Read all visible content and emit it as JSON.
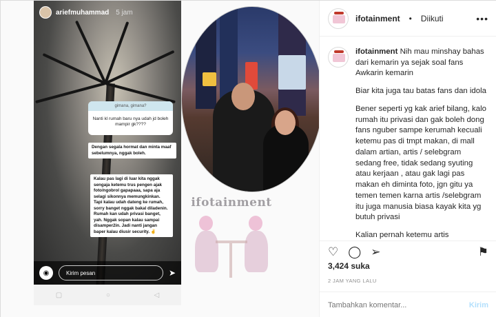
{
  "story": {
    "username": "ariefmuhammad",
    "time": "5 jam",
    "question_header": "gimana, gimana?",
    "question_text": "Nanti kl rumah baru nya udah jd boleh mampir gk????",
    "reply1": "Dengan segala hormat dan minta maaf sebelumnya, nggak boleh.",
    "reply2": "Kalau pas lagi di luar kita nggak sengaja ketemu trus pengen ajak foto/ngobrol gapapaaa, sapa aja selagi sikonnya memungkinkan. Tapi kalau udah dateng ke rumah, sorry banget nggak bakal diladenin. Rumah kan udah privasi banget, yah. Nggak sopan kalau sampai disamper2in. Jadi nanti jangan baper kalau diusir security. ✌",
    "message_placeholder": "Kirim pesan",
    "camera_icon": "camera-icon",
    "send_icon": "send-icon"
  },
  "watermark": {
    "text": "ifotainment"
  },
  "post": {
    "header_username": "ifotainment",
    "header_dot": "•",
    "header_follow_status": "Diikuti",
    "caption_username": "ifotainment",
    "caption_first": "Nih mau minshay bahas dari kemarin ya sejak soal fans Awkarin kemarin",
    "paragraphs": [
      "Biar kita juga tau batas fans dan idola",
      "Bener seperti yg kak arief bilang, kalo rumah itu privasi dan gak boleh dong fans nguber sampe kerumah kecuali ketemu pas di tmpt makan, di mall dalam artian, artis / selebgram sedang free, tidak sedang syuting atau kerjaan , atau gak lagi pas makan eh diminta foto, jgn gitu ya temen temen karna artis /selebgram itu juga manusia biasa kayak kita yg butuh privasi",
      "Kalian pernah ketemu artis /selebgram gak? Siapa menurut kalian yg paling baik ??? Drop"
    ],
    "likes": "3,424 suka",
    "time_ago": "2 JAM YANG LALU",
    "comment_placeholder": "Tambahkan komentar...",
    "post_button": "Kirim"
  }
}
